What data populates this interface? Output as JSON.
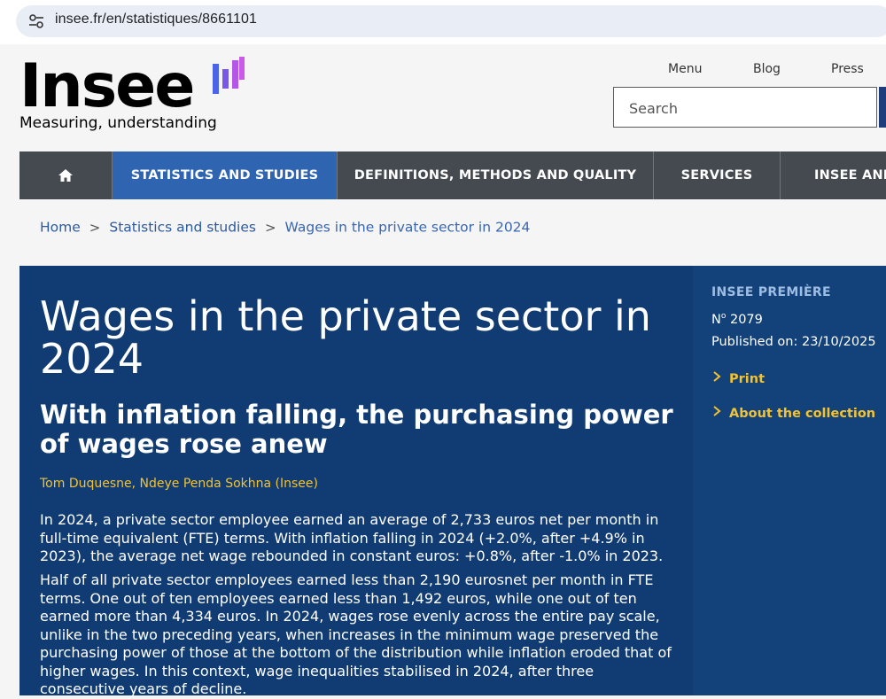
{
  "browser": {
    "url": "insee.fr/en/statistiques/8661101"
  },
  "header": {
    "logo_word": "Insee",
    "tagline": "Measuring, understanding",
    "links": [
      "Menu",
      "Blog",
      "Press"
    ],
    "search_placeholder": "Search"
  },
  "nav": {
    "home_icon": "home-icon",
    "items": [
      "STATISTICS AND STUDIES",
      "DEFINITIONS, METHODS AND QUALITY",
      "SERVICES",
      "INSEE AND"
    ]
  },
  "breadcrumb": {
    "items": [
      "Home",
      "Statistics and studies",
      "Wages in the private sector in 2024"
    ]
  },
  "article": {
    "title": "Wages in the private sector in 2024",
    "subtitle": "With inflation falling, the purchasing power of wages rose anew",
    "authors": "Tom Duquesne, Ndeye Penda Sokhna (Insee)",
    "paragraphs": [
      "In 2024, a private sector employee earned an average of 2,733 euros net per month in full-time equivalent (FTE) terms. With inflation falling in 2024 (+2.0%, after +4.9% in 2023), the average net wage rebounded in constant euros: +0.8%, after -1.0% in 2023.",
      "Half of all private sector employees earned less than 2,190 eurosnet per month in FTE terms. One out of ten employees earned less than 1,492 euros, while one out of ten earned more than 4,334 euros. In 2024, wages rose evenly across the entire pay scale, unlike in the two preceding years, when increases in the minimum wage preserved the purchasing power of those at the bottom of the distribution while inflation eroded that of higher wages. In this context, wage inequalities stabilised in 2024, after three consecutive years of decline."
    ]
  },
  "sidebar": {
    "collection": "INSEE PREMIÈRE",
    "number_prefix": "N",
    "number_sup": "o",
    "number": " 2079",
    "published": "Published on: 23/10/2025",
    "links": [
      "Print",
      "About the collection"
    ]
  },
  "colors": {
    "brand_blue": "#113c73",
    "nav_active": "#2f64b1",
    "nav_bg": "#444a50",
    "accent_yellow": "#f1c232"
  }
}
